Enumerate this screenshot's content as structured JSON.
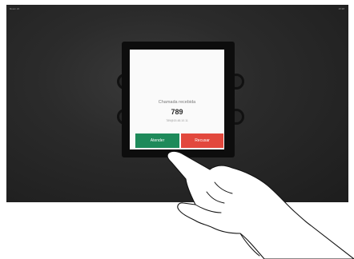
{
  "status_bar": {
    "left_text": "Room 21",
    "right_text": "15:38"
  },
  "incoming_call": {
    "title": "Chamada recebida",
    "number": "789",
    "detail": "789@15.48.10.11",
    "answer_label": "Atender",
    "decline_label": "Recusar"
  },
  "colors": {
    "answer": "#1e8a5a",
    "decline": "#e2483d",
    "screen_background": "#2b2b2b"
  },
  "icons": [
    "pointing-hand-icon"
  ]
}
